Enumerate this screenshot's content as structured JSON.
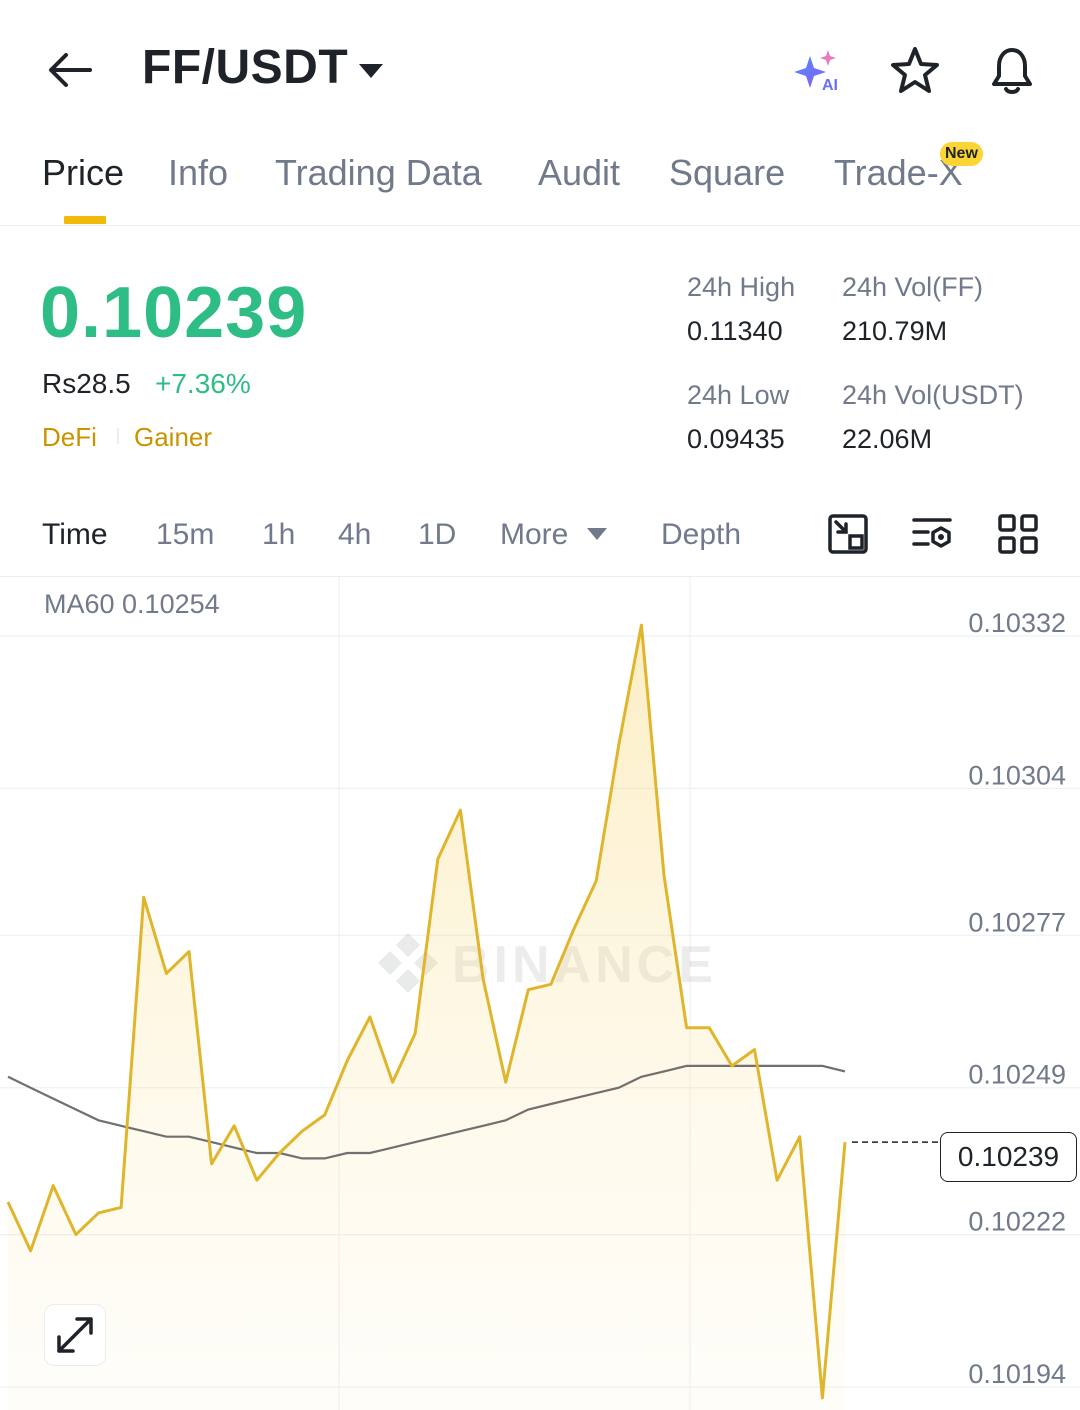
{
  "header": {
    "pair": "FF/USDT",
    "ai_label": "AI"
  },
  "tabs": [
    {
      "label": "Price",
      "active": true
    },
    {
      "label": "Info"
    },
    {
      "label": "Trading Data"
    },
    {
      "label": "Audit"
    },
    {
      "label": "Square"
    },
    {
      "label": "Trade-X",
      "badge": "New"
    }
  ],
  "ticker": {
    "last_price": "0.10239",
    "fiat_price": "Rs28.5",
    "change": "+7.36%",
    "tags": [
      "DeFi",
      "Gainer"
    ],
    "stats": {
      "high_label": "24h High",
      "high_value": "0.11340",
      "vol_ff_label": "24h Vol(FF)",
      "vol_ff_value": "210.79M",
      "low_label": "24h Low",
      "low_value": "0.09435",
      "vol_usdt_label": "24h Vol(USDT)",
      "vol_usdt_value": "22.06M"
    }
  },
  "intervals": {
    "items": [
      "Time",
      "15m",
      "1h",
      "4h",
      "1D",
      "More"
    ],
    "active": "Time",
    "depth": "Depth"
  },
  "colors": {
    "accent": "#f0b90b",
    "up": "#2ebd85",
    "line": "#e0b52b",
    "ma": "#707070"
  },
  "chart_data": {
    "type": "area",
    "ma_label": "MA60 0.10254",
    "current_price_label": "0.10239",
    "current_price": 0.10239,
    "watermark": "BINANCE",
    "ylim": [
      0.10188,
      0.10345
    ],
    "y_ticks": [
      "0.10332",
      "0.10304",
      "0.10277",
      "0.10249",
      "0.10222",
      "0.10194"
    ],
    "y_tick_values": [
      0.10332,
      0.10304,
      0.10277,
      0.10249,
      0.10222,
      0.10194
    ],
    "grid": true,
    "series": [
      {
        "values": [
          0.10228,
          0.10219,
          0.10231,
          0.10222,
          0.10226,
          0.10227,
          0.10284,
          0.1027,
          0.10274,
          0.10235,
          0.10242,
          0.10232,
          0.10237,
          0.10241,
          0.10244,
          0.10254,
          0.10262,
          0.1025,
          0.10259,
          0.10291,
          0.103,
          0.10269,
          0.1025,
          0.10267,
          0.10268,
          0.10278,
          0.10287,
          0.10312,
          0.10334,
          0.10288,
          0.1026,
          0.1026,
          0.10253,
          0.10256,
          0.10232,
          0.1024,
          0.10192,
          0.10239
        ]
      },
      {
        "values": [
          0.10251,
          0.10249,
          0.10247,
          0.10245,
          0.10243,
          0.10242,
          0.10241,
          0.1024,
          0.1024,
          0.10239,
          0.10238,
          0.10237,
          0.10237,
          0.10236,
          0.10236,
          0.10237,
          0.10237,
          0.10238,
          0.10239,
          0.1024,
          0.10241,
          0.10242,
          0.10243,
          0.10245,
          0.10246,
          0.10247,
          0.10248,
          0.10249,
          0.10251,
          0.10252,
          0.10253,
          0.10253,
          0.10253,
          0.10253,
          0.10253,
          0.10253,
          0.10253,
          0.10252
        ]
      }
    ]
  }
}
